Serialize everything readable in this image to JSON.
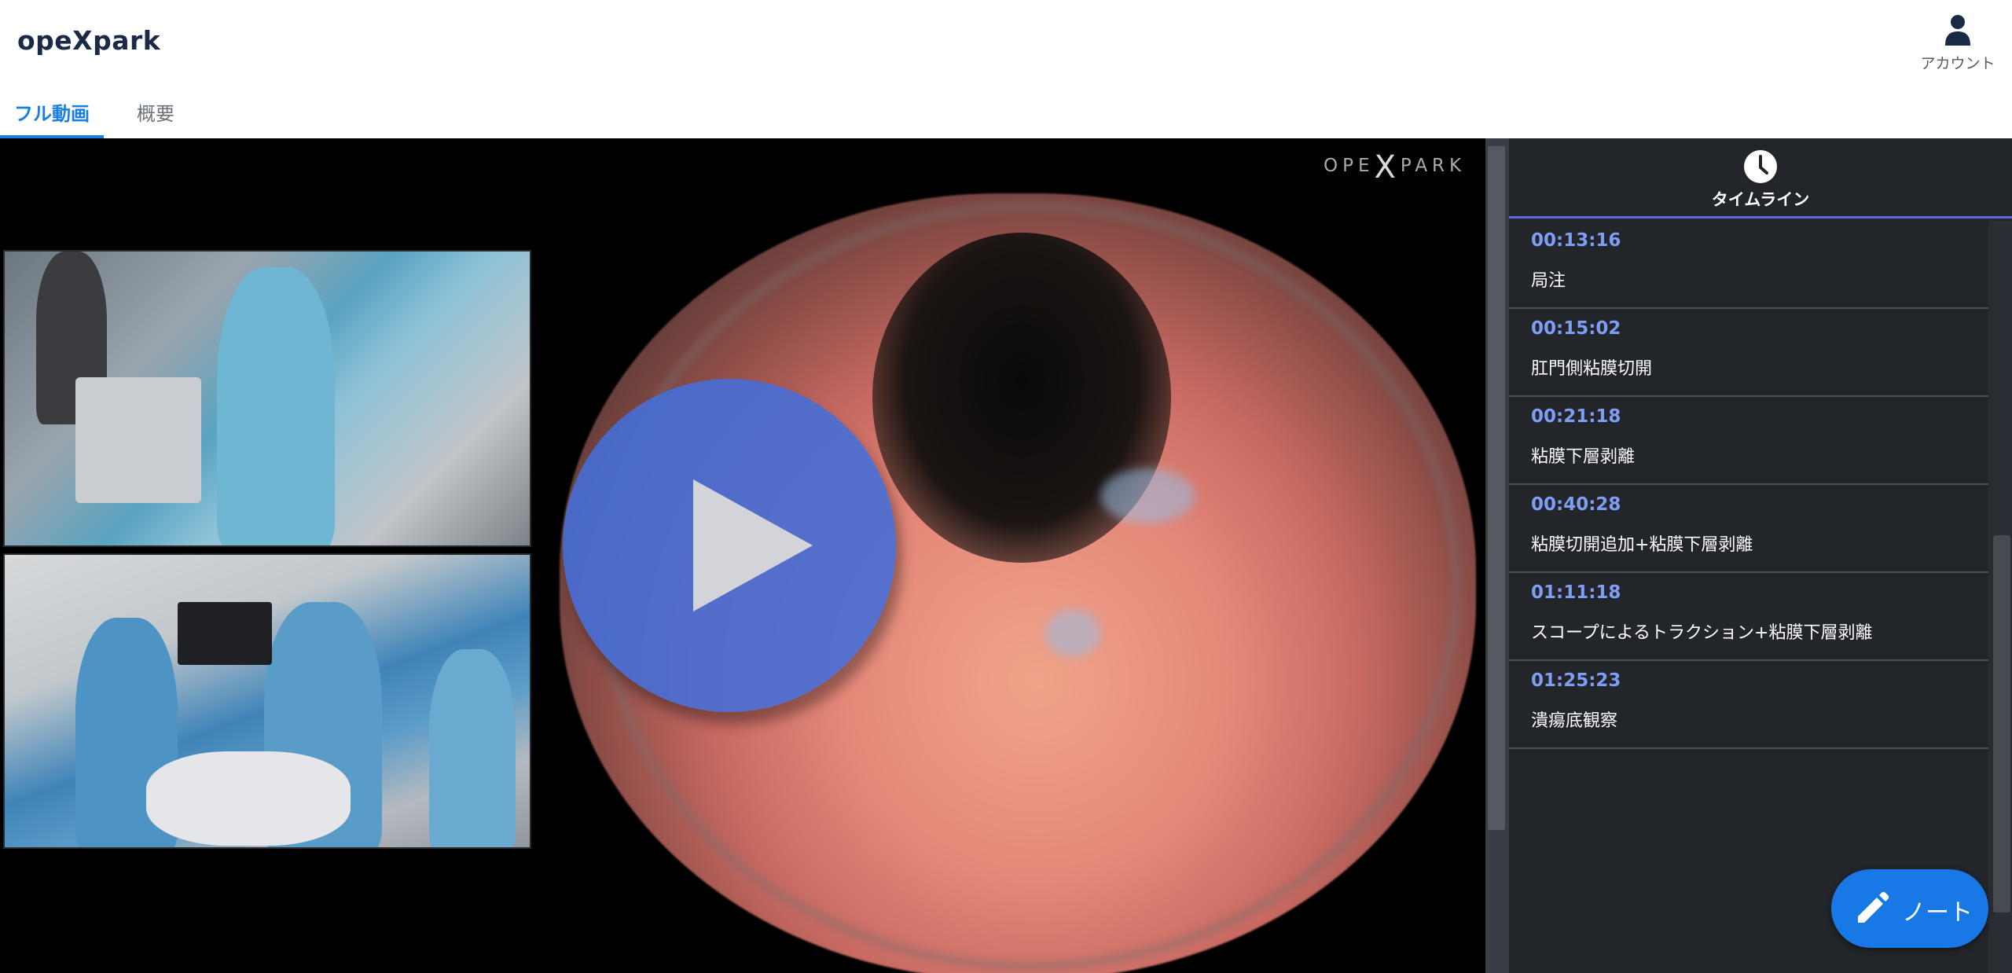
{
  "app": {
    "logo": "opeXpark"
  },
  "header": {
    "account_label": "アカウント",
    "account_icon": "user-icon"
  },
  "tabs": [
    {
      "label": "フル動画",
      "active": true
    },
    {
      "label": "概要",
      "active": false
    }
  ],
  "video": {
    "watermark": {
      "left": "OPE",
      "mark": "X",
      "right": "PARK"
    },
    "play_icon": "play-icon"
  },
  "timeline": {
    "title": "タイムライン",
    "icon": "clock-icon",
    "items": [
      {
        "time": "00:13:16",
        "label": "局注"
      },
      {
        "time": "00:15:02",
        "label": "肛門側粘膜切開"
      },
      {
        "time": "00:21:18",
        "label": "粘膜下層剥離"
      },
      {
        "time": "00:40:28",
        "label": "粘膜切開追加+粘膜下層剥離"
      },
      {
        "time": "01:11:18",
        "label": "スコープによるトラクション+粘膜下層剥離"
      },
      {
        "time": "01:25:23",
        "label": "潰瘍底観察"
      }
    ]
  },
  "note_button": {
    "label": "ノート",
    "icon": "pencil-icon"
  },
  "colors": {
    "accent": "#1a7fe0",
    "timeline_time": "#7d9ef2",
    "panel_bg": "#22252a",
    "play_button": "#466ed6",
    "note_button": "#1778e6"
  }
}
